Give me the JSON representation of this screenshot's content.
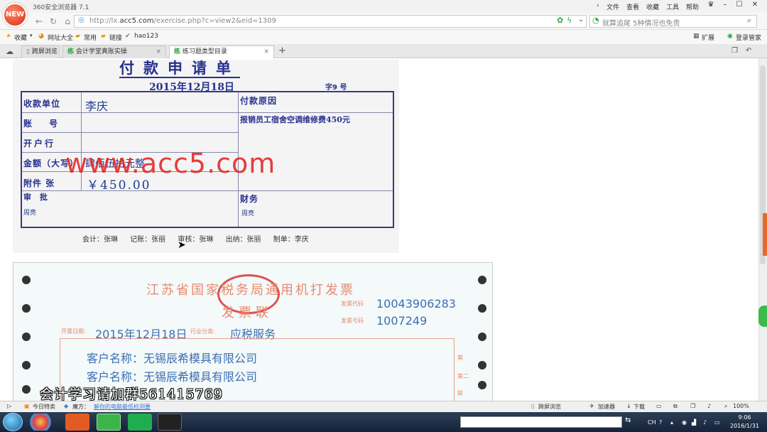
{
  "browser": {
    "title": "360安全浏览器 7.1",
    "logo_text": "NEW",
    "menu": [
      "文件",
      "查看",
      "收藏",
      "工具",
      "帮助"
    ],
    "url_prefix": "http://lx.",
    "url_domain": "acc5.com",
    "url_path": "/exercise.php?c=view2&eid=1309",
    "search_placeholder": "就算追尾 5种情况也免责",
    "extensions_label": "扩展",
    "login_label": "登录管家"
  },
  "bookmarks": [
    {
      "label": "收藏"
    },
    {
      "label": "网址大全"
    },
    {
      "label": "常用"
    },
    {
      "label": "链接"
    },
    {
      "label": "hao123"
    }
  ],
  "tabs": [
    {
      "label": "跨屏浏览"
    },
    {
      "label": "会计学堂真账实操",
      "icon_text": "练"
    },
    {
      "label": "练习题类型目录",
      "icon_text": "练"
    }
  ],
  "payment": {
    "title": "付款申请单",
    "date": "2015年12月18日",
    "number": "字9 号",
    "payee_label": "收款单位",
    "payee_value": "李庆",
    "account_label": "账  号",
    "bank_label": "开户行",
    "amount_label": "金额（大写）",
    "amount_value": "肆佰伍拾元整",
    "attach_label": "附件 张",
    "amount_num": "￥450.00",
    "reason_label": "付款原因",
    "reason_value": "报销员工宿舍空调维修费450元",
    "approve_label": "审  批",
    "approve_sign": "周亮",
    "finance_label": "财务",
    "finance_sign": "周亮",
    "signers": "会计：张琳 记账：张丽 审核：张琳 出纳：张丽 制单：李庆"
  },
  "watermark": "www.acc5.com",
  "invoice": {
    "title": "江苏省国家税务局通用机打发票",
    "subtitle": "发票联",
    "code_label": "发票代码",
    "code_value": "10043906283",
    "number_label": "发票号码",
    "number_value": "1007249",
    "date_label": "开票日期:",
    "date_value": "2015年12月18日",
    "industry_label": "行业分类:",
    "industry_value": "应税服务",
    "customer_line1": "客户名称：无锡辰希模具有限公司",
    "customer_line2": "客户名称：无锡辰希模具有限公司",
    "side_labels": [
      "第",
      "第二",
      "联"
    ]
  },
  "overlay_text": "会计学习请加群561415769",
  "statusbar": {
    "items": [
      "今日特卖",
      "魔方：",
      "解你的电脑最低检测要"
    ],
    "right": [
      "跨屏浏览",
      "加速器",
      "下载"
    ],
    "zoom": "100%"
  },
  "taskbar": {
    "lang": "CH",
    "time": "9:06",
    "date": "2016/1/31"
  }
}
